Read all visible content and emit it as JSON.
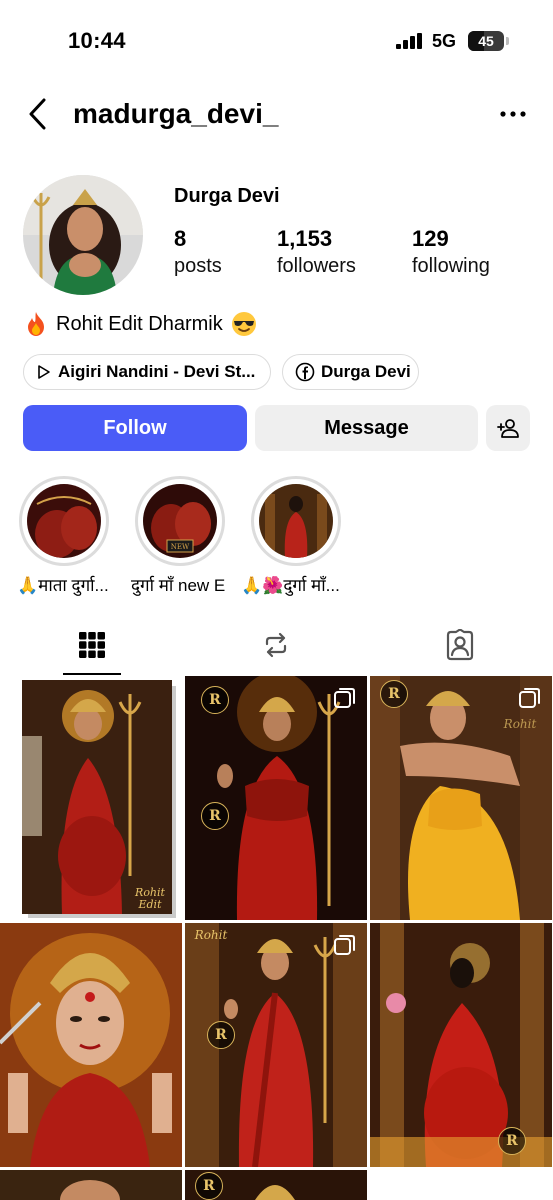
{
  "status_bar": {
    "time": "10:44",
    "network": "5G",
    "battery": "45",
    "battery_level": 0.45
  },
  "header": {
    "username": "madurga_devi_",
    "back_icon": "chevron-left-icon",
    "more_icon": "more-horizontal-icon"
  },
  "profile": {
    "display_name": "Durga Devi",
    "stats": [
      {
        "value": "8",
        "label": "posts"
      },
      {
        "value": "1,153",
        "label": "followers"
      },
      {
        "value": "129",
        "label": "following"
      }
    ],
    "bio": "Rohit Edit Dharmik"
  },
  "chips": [
    {
      "icon": "play-icon",
      "label": "Aigiri Nandini - Devi St..."
    },
    {
      "icon": "facebook-icon",
      "label": "Durga Devi"
    }
  ],
  "actions": {
    "follow": "Follow",
    "message": "Message",
    "add_user_icon": "add-user-icon"
  },
  "highlights": [
    {
      "label": "🙏माता दुर्गा..."
    },
    {
      "label": "दुर्गा माँ new E"
    },
    {
      "label": "🙏🌺दुर्गा माँ..."
    }
  ],
  "tabs": [
    {
      "icon": "grid-icon",
      "active": true
    },
    {
      "icon": "reels-repost-icon",
      "active": false
    },
    {
      "icon": "tagged-person-icon",
      "active": false
    }
  ],
  "colors": {
    "accent": "#4a5cf7",
    "button_gray": "#efefef",
    "chip_border": "#dcdcdc"
  }
}
